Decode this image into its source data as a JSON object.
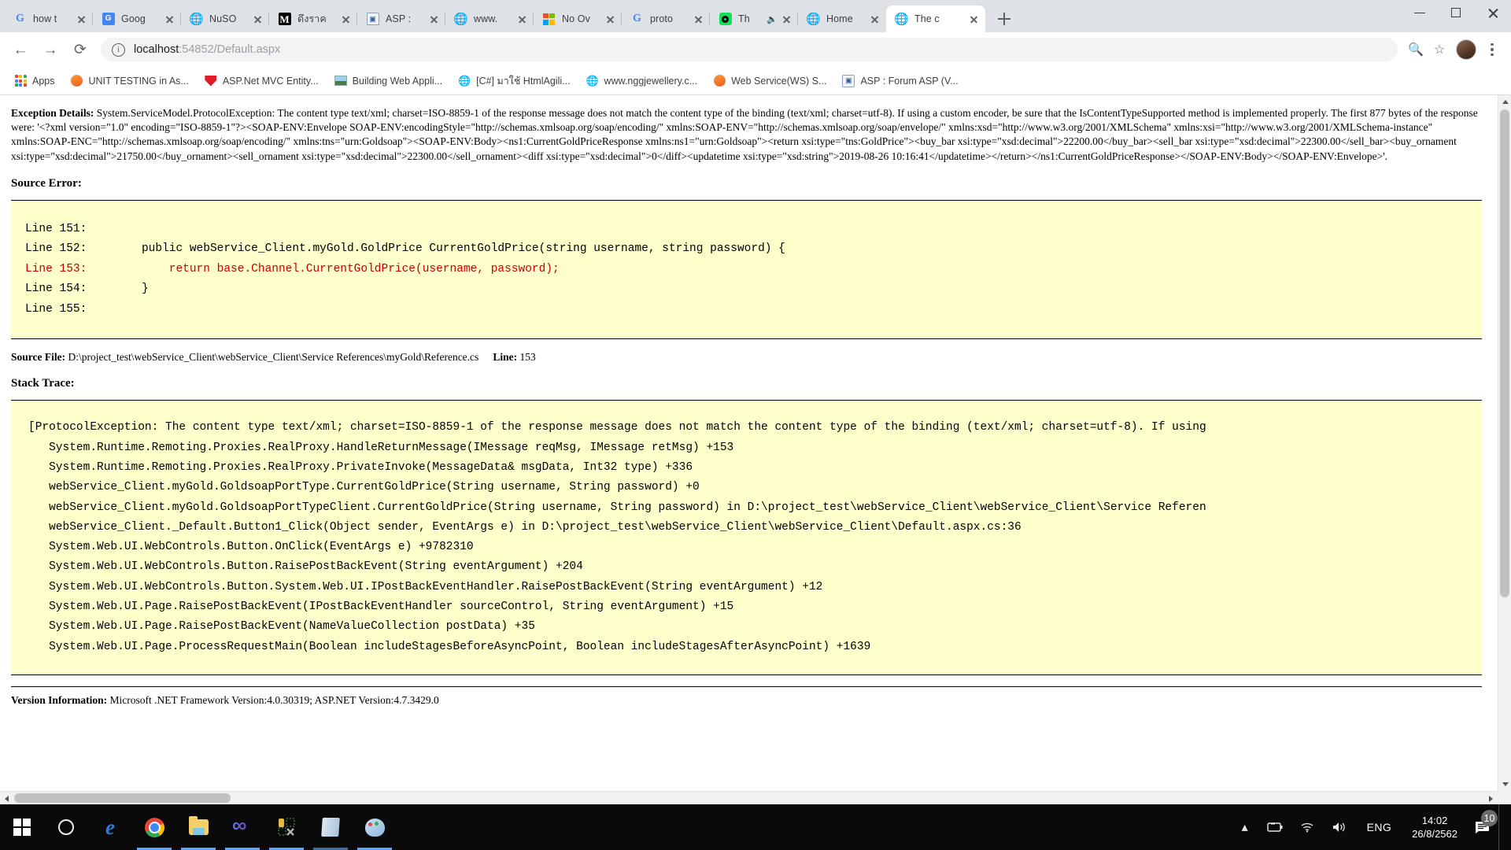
{
  "browser": {
    "tabs": [
      {
        "title": "how t",
        "icon": "google-icon",
        "active": false
      },
      {
        "title": "Goog",
        "icon": "google-translate-icon",
        "active": false
      },
      {
        "title": "NuSO",
        "icon": "globe-icon",
        "active": false
      },
      {
        "title": "ดึงราค",
        "icon": "medium-icon",
        "active": false
      },
      {
        "title": "ASP :",
        "icon": "asp-forum-icon",
        "active": false
      },
      {
        "title": "www.",
        "icon": "globe-icon",
        "active": false
      },
      {
        "title": "No Ov",
        "icon": "microsoft-icon",
        "active": false
      },
      {
        "title": "proto",
        "icon": "google-icon",
        "active": false
      },
      {
        "title": "Th",
        "icon": "spotify-icon",
        "active": false,
        "muted": true
      },
      {
        "title": "Home",
        "icon": "globe-icon",
        "active": false
      },
      {
        "title": "The c",
        "icon": "globe-icon",
        "active": true
      }
    ],
    "new_tab_label": "New tab",
    "window_controls": {
      "minimize": "Minimize",
      "maximize": "Maximize",
      "close": "Close"
    },
    "nav": {
      "back": "Back",
      "forward": "Forward",
      "reload": "Reload"
    },
    "omnibox": {
      "site_info": "Site information",
      "url_host": "localhost",
      "url_path": ":54852/Default.aspx",
      "url_full": "localhost:54852/Default.aspx",
      "zoom_icon": "search-icon",
      "bookmark_icon": "star-icon"
    },
    "profile": "Profile",
    "menu": "Customize and control Google Chrome",
    "bookmarks": [
      {
        "label": "Apps",
        "icon": "apps-grid-icon"
      },
      {
        "label": "UNIT TESTING in As...",
        "icon": "orange-circle-icon"
      },
      {
        "label": "ASP.Net MVC Entity...",
        "icon": "red-shield-icon"
      },
      {
        "label": "Building Web Appli...",
        "icon": "image-thumb-icon"
      },
      {
        "label": "[C#] มาใช้ HtmlAgili...",
        "icon": "globe-icon"
      },
      {
        "label": "www.nggjewellery.c...",
        "icon": "globe-icon"
      },
      {
        "label": "Web Service(WS) S...",
        "icon": "orange-circle-icon"
      },
      {
        "label": "ASP : Forum ASP (V...",
        "icon": "asp-forum-icon"
      }
    ]
  },
  "content": {
    "exception_details_label": "Exception Details:",
    "exception_details_text": " System.ServiceModel.ProtocolException: The content type text/xml; charset=ISO-8859-1 of the response message does not match the content type of the binding (text/xml; charset=utf-8). If using a custom encoder, be sure that the IsContentTypeSupported method is implemented properly. The first 877 bytes of the response were: '<?xml version=\"1.0\" encoding=\"ISO-8859-1\"?><SOAP-ENV:Envelope SOAP-ENV:encodingStyle=\"http://schemas.xmlsoap.org/soap/encoding/\" xmlns:SOAP-ENV=\"http://schemas.xmlsoap.org/soap/envelope/\" xmlns:xsd=\"http://www.w3.org/2001/XMLSchema\" xmlns:xsi=\"http://www.w3.org/2001/XMLSchema-instance\" xmlns:SOAP-ENC=\"http://schemas.xmlsoap.org/soap/encoding/\" xmlns:tns=\"urn:Goldsoap\"><SOAP-ENV:Body><ns1:CurrentGoldPriceResponse xmlns:ns1=\"urn:Goldsoap\"><return xsi:type=\"tns:GoldPrice\"><buy_bar xsi:type=\"xsd:decimal\">22200.00</buy_bar><sell_bar xsi:type=\"xsd:decimal\">22300.00</sell_bar><buy_ornament xsi:type=\"xsd:decimal\">21750.00</buy_ornament><sell_ornament xsi:type=\"xsd:decimal\">22300.00</sell_ornament><diff xsi:type=\"xsd:decimal\">0</diff><updatetime xsi:type=\"xsd:string\">2019-08-26 10:16:41</updatetime></return></ns1:CurrentGoldPriceResponse></SOAP-ENV:Body></SOAP-ENV:Envelope>'.",
    "source_error_label": "Source Error:",
    "source_lines": [
      {
        "num": "Line 151:",
        "code": "",
        "highlight": false
      },
      {
        "num": "Line 152:",
        "code": "        public webService_Client.myGold.GoldPrice CurrentGoldPrice(string username, string password) {",
        "highlight": false
      },
      {
        "num": "Line 153:",
        "code": "            return base.Channel.CurrentGoldPrice(username, password);",
        "highlight": true
      },
      {
        "num": "Line 154:",
        "code": "        }",
        "highlight": false
      },
      {
        "num": "Line 155:",
        "code": "",
        "highlight": false
      }
    ],
    "source_file_label": "Source File:",
    "source_file_path": "D:\\project_test\\webService_Client\\webService_Client\\Service References\\myGold\\Reference.cs",
    "source_line_label": "Line:",
    "source_line_value": "153",
    "stack_trace_label": "Stack Trace:",
    "stack_trace_lines": [
      "[ProtocolException: The content type text/xml; charset=ISO-8859-1 of the response message does not match the content type of the binding (text/xml; charset=utf-8). If using",
      "   System.Runtime.Remoting.Proxies.RealProxy.HandleReturnMessage(IMessage reqMsg, IMessage retMsg) +153",
      "   System.Runtime.Remoting.Proxies.RealProxy.PrivateInvoke(MessageData& msgData, Int32 type) +336",
      "   webService_Client.myGold.GoldsoapPortType.CurrentGoldPrice(String username, String password) +0",
      "   webService_Client.myGold.GoldsoapPortTypeClient.CurrentGoldPrice(String username, String password) in D:\\project_test\\webService_Client\\webService_Client\\Service Referen",
      "   webService_Client._Default.Button1_Click(Object sender, EventArgs e) in D:\\project_test\\webService_Client\\webService_Client\\Default.aspx.cs:36",
      "   System.Web.UI.WebControls.Button.OnClick(EventArgs e) +9782310",
      "   System.Web.UI.WebControls.Button.RaisePostBackEvent(String eventArgument) +204",
      "   System.Web.UI.WebControls.Button.System.Web.UI.IPostBackEventHandler.RaisePostBackEvent(String eventArgument) +12",
      "   System.Web.UI.Page.RaisePostBackEvent(IPostBackEventHandler sourceControl, String eventArgument) +15",
      "   System.Web.UI.Page.RaisePostBackEvent(NameValueCollection postData) +35",
      "   System.Web.UI.Page.ProcessRequestMain(Boolean includeStagesBeforeAsyncPoint, Boolean includeStagesAfterAsyncPoint) +1639"
    ],
    "version_info_label": "Version Information:",
    "version_info_text": " Microsoft .NET Framework Version:4.0.30319; ASP.NET Version:4.7.3429.0"
  },
  "taskbar": {
    "items": [
      {
        "name": "start-button",
        "icon": "windows-logo-icon",
        "open": false
      },
      {
        "name": "cortana-button",
        "icon": "cortana-circle-icon",
        "open": false
      },
      {
        "name": "edge-button",
        "icon": "edge-icon",
        "open": false
      },
      {
        "name": "chrome-button",
        "icon": "chrome-icon",
        "open": true
      },
      {
        "name": "file-explorer-button",
        "icon": "folder-icon",
        "open": true
      },
      {
        "name": "visual-studio-button",
        "icon": "visual-studio-icon",
        "open": true
      },
      {
        "name": "sql-server-button",
        "icon": "sql-server-icon",
        "open": true
      },
      {
        "name": "notepad-button",
        "icon": "notepad-icon",
        "open": true
      },
      {
        "name": "paint-button",
        "icon": "paint-icon",
        "open": true
      }
    ],
    "tray": {
      "overflow": "show-hidden-icons",
      "battery": "battery-charging-icon",
      "network": "wifi-icon",
      "volume": "speaker-icon",
      "language": "ENG",
      "time": "14:02",
      "date": "26/8/2562",
      "notifications_count": "10"
    }
  },
  "colors": {
    "chrome_toolbar": "#ffffff",
    "tabstrip": "#dee1e6",
    "code_background": "#ffffcc",
    "error_line": "#cc0000",
    "taskbar": "#0a0a0a",
    "taskbar_active": "#58a6ff"
  }
}
